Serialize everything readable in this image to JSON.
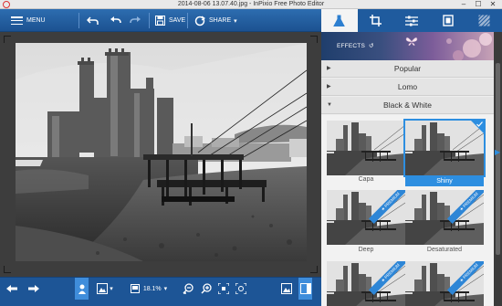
{
  "window": {
    "title": "2014-08-06 13.07.40.jpg - InPixio Free Photo Editor",
    "minimize": "–",
    "maximize": "☐",
    "close": "✕"
  },
  "toolbar": {
    "menu_label": "MENU",
    "save_label": "SAVE",
    "share_label": "SHARE",
    "share_arrow": "▾"
  },
  "bottombar": {
    "zoom": "18.1%",
    "dropdown_arrow": "▾"
  },
  "effects": {
    "label": "EFFECTS"
  },
  "sections": [
    {
      "label": "Popular",
      "arrow": "▶"
    },
    {
      "label": "Lomo",
      "arrow": "▶"
    },
    {
      "label": "Black & White",
      "arrow": "▼"
    }
  ],
  "thumbnails": [
    {
      "label": "Capa",
      "selected": false,
      "premium": false
    },
    {
      "label": "Shiny",
      "selected": true,
      "premium": false
    },
    {
      "label": "Deep",
      "selected": false,
      "premium": true
    },
    {
      "label": "Desaturated",
      "selected": false,
      "premium": true
    },
    {
      "label": "",
      "selected": false,
      "premium": true
    },
    {
      "label": "",
      "selected": false,
      "premium": true
    }
  ],
  "premium_badge": "★ PREMIUM",
  "colors": {
    "toolbar_blue": "#1c5291",
    "accent": "#2d8ee0"
  }
}
